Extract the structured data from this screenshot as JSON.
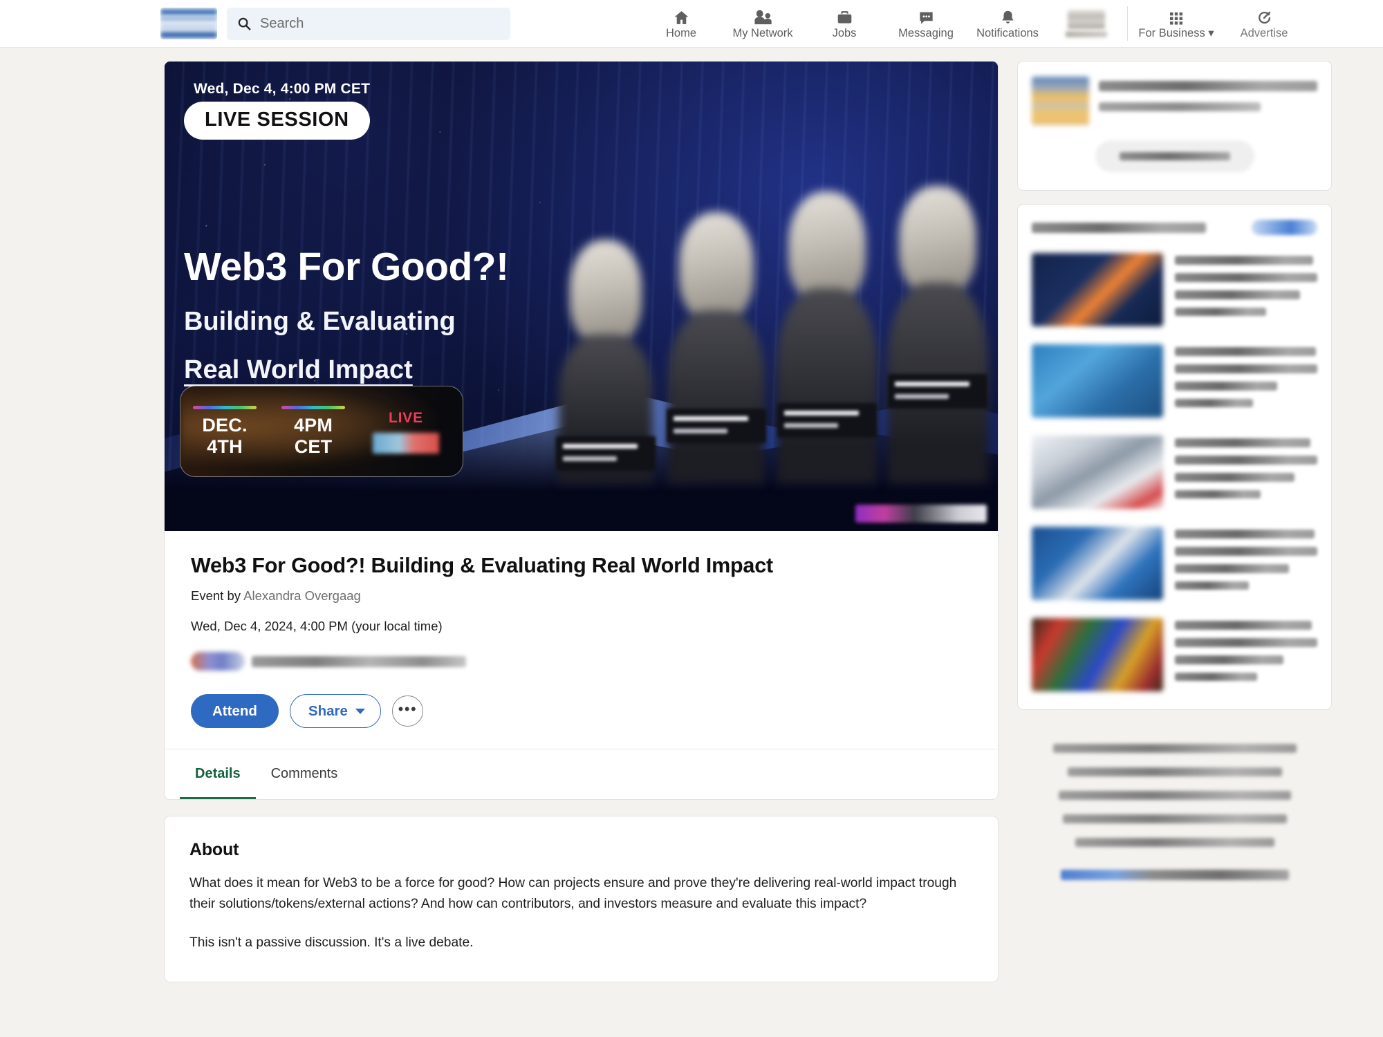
{
  "nav": {
    "logo_name": "linkedin-logo",
    "search": {
      "placeholder": "Search",
      "value": "Search",
      "icon": "search-icon"
    },
    "items": [
      {
        "label": "Home",
        "icon": "home-icon"
      },
      {
        "label": "My Network",
        "icon": "people-icon"
      },
      {
        "label": "Jobs",
        "icon": "briefcase-icon"
      },
      {
        "label": "Messaging",
        "icon": "message-bubble-icon"
      },
      {
        "label": "Notifications",
        "icon": "bell-icon"
      }
    ],
    "me": {
      "label": "",
      "icon": "avatar-icon"
    },
    "business": {
      "label": "For Business",
      "icon": "grid-apps-icon"
    },
    "advertise": {
      "label": "Advertise",
      "icon": "advertise-target-icon"
    }
  },
  "banner": {
    "date_line": "Wed, Dec 4, 4:00 PM CET",
    "live_badge": "LIVE SESSION",
    "headline": "Web3 For Good?!",
    "subline_1": "Building & Evaluating",
    "subline_2": "Real World Impact",
    "pill": {
      "date_top": "DEC.",
      "date_bottom": "4TH",
      "time_top": "4PM",
      "time_bottom": "CET",
      "live_label": "LIVE"
    }
  },
  "event": {
    "title": "Web3 For Good?! Building & Evaluating Real World Impact",
    "by_prefix": "Event by",
    "host": "Alexandra Overgaag",
    "datetime": "Wed, Dec 4, 2024, 4:00 PM (your local time)",
    "attend_label": "Attend",
    "share_label": "Share",
    "more_label": "•••"
  },
  "tabs": [
    {
      "label": "Details",
      "active": true
    },
    {
      "label": "Comments",
      "active": false
    }
  ],
  "about": {
    "heading": "About",
    "paragraph_1": "What does it mean for Web3 to be a force for good? How can projects ensure and prove they're delivering real-world impact trough their solutions/tokens/external actions? And how can contributors, and investors measure and evaluate this impact?",
    "paragraph_2": "This isn't a passive discussion. It's a live debate."
  },
  "colors": {
    "page_background": "#f4f2ee",
    "card_background": "#ffffff",
    "primary_blue": "#2f6ac2",
    "active_tab_green": "#1b6b47",
    "banner_dark": "#05081c",
    "live_red": "#ef3b5b"
  }
}
